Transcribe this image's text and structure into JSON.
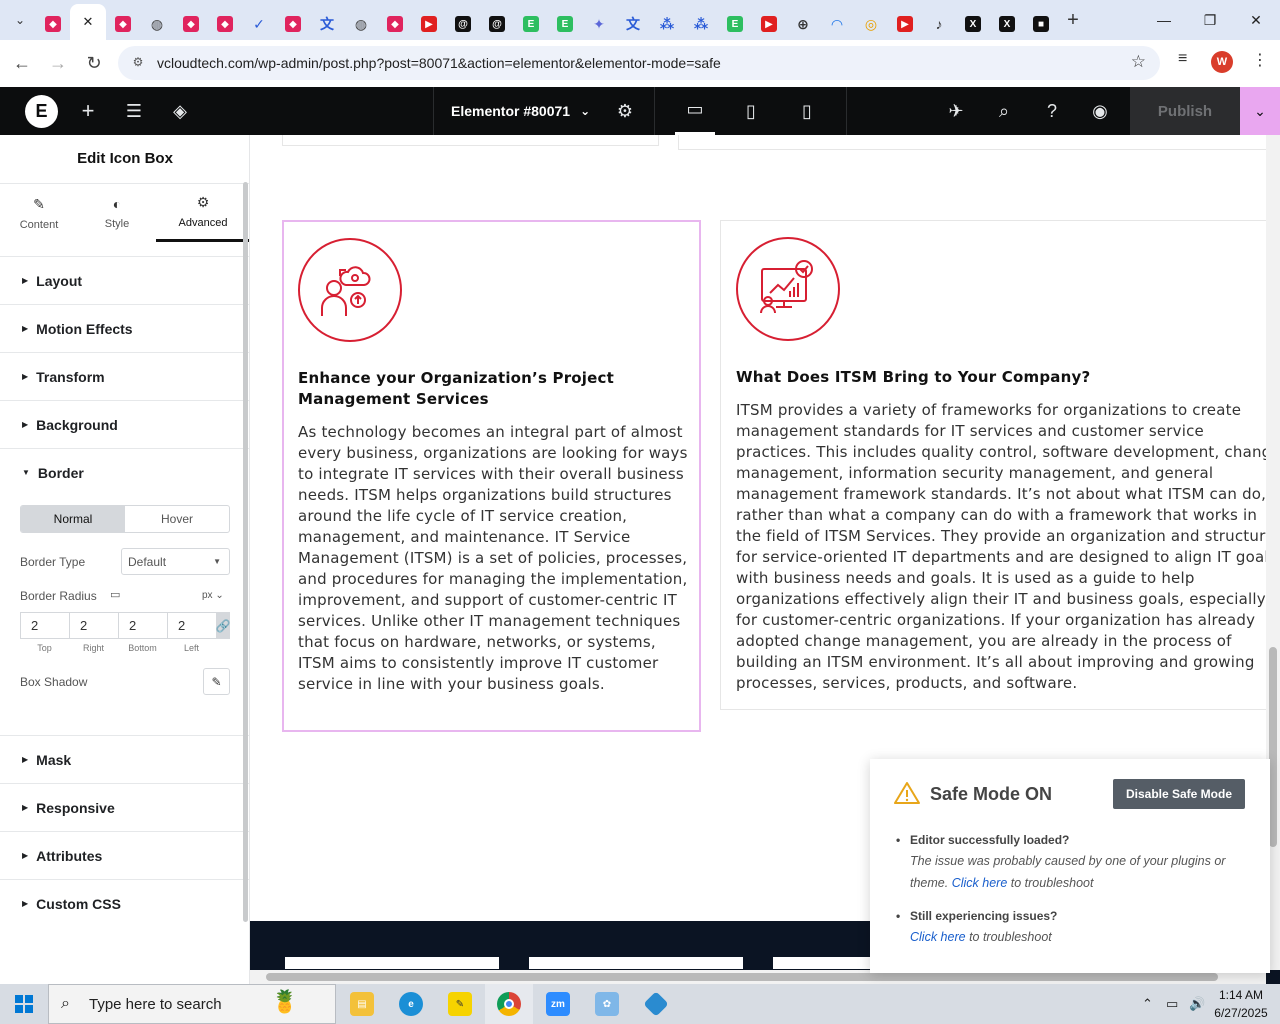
{
  "browser": {
    "url": "vcloudtech.com/wp-admin/post.php?post=80071&action=elementor&elementor-mode=safe",
    "profile_initial": "W",
    "tabs": [
      {
        "icon": "elementor-tab-icon",
        "color": "#e0245e",
        "glyph": "◆"
      },
      {
        "icon": "close-icon",
        "color": "#333",
        "glyph": "✕",
        "active": true
      },
      {
        "icon": "elementor-tab-icon",
        "color": "#e0245e",
        "glyph": "◆"
      },
      {
        "icon": "globe-icon",
        "color": "#444",
        "glyph": "◍"
      },
      {
        "icon": "elementor-tab-icon",
        "color": "#e0245e",
        "glyph": "◆"
      },
      {
        "icon": "elementor-tab-icon",
        "color": "#e0245e",
        "glyph": "◆"
      },
      {
        "icon": "check-icon",
        "color": "#2a5bd7",
        "glyph": "✓"
      },
      {
        "icon": "elementor-tab-icon",
        "color": "#e0245e",
        "glyph": "◆"
      },
      {
        "icon": "translate-icon",
        "color": "#2a5bd7",
        "glyph": "文"
      },
      {
        "icon": "globe-icon",
        "color": "#444",
        "glyph": "◍"
      },
      {
        "icon": "elementor-tab-icon",
        "color": "#e0245e",
        "glyph": "◆"
      },
      {
        "icon": "youtube-icon",
        "color": "#e02020",
        "glyph": "▶"
      },
      {
        "icon": "threads-icon",
        "color": "#111",
        "glyph": "@"
      },
      {
        "icon": "threads-icon",
        "color": "#111",
        "glyph": "@"
      },
      {
        "icon": "evernote-icon",
        "color": "#2dbe60",
        "glyph": "E"
      },
      {
        "icon": "evernote-icon",
        "color": "#2dbe60",
        "glyph": "E"
      },
      {
        "icon": "gemini-icon",
        "color": "#5b67d8",
        "glyph": "✦"
      },
      {
        "icon": "translate-icon",
        "color": "#2a5bd7",
        "glyph": "文"
      },
      {
        "icon": "grid-icon",
        "color": "#2a5bd7",
        "glyph": "⁂"
      },
      {
        "icon": "grid-icon",
        "color": "#2a5bd7",
        "glyph": "⁂"
      },
      {
        "icon": "evernote-icon",
        "color": "#2dbe60",
        "glyph": "E"
      },
      {
        "icon": "youtube-icon",
        "color": "#e02020",
        "glyph": "▶"
      },
      {
        "icon": "lock-icon",
        "color": "#333",
        "glyph": "⊕"
      },
      {
        "icon": "wifi-icon",
        "color": "#1a73e8",
        "glyph": "◠"
      },
      {
        "icon": "circle-icon",
        "color": "#e8a000",
        "glyph": "◎"
      },
      {
        "icon": "youtube-icon",
        "color": "#e02020",
        "glyph": "▶"
      },
      {
        "icon": "audio-icon",
        "color": "#333",
        "glyph": "♪"
      },
      {
        "icon": "x-icon",
        "color": "#111",
        "glyph": "X"
      },
      {
        "icon": "x-icon",
        "color": "#111",
        "glyph": "X"
      },
      {
        "icon": "app-icon",
        "color": "#111",
        "glyph": "■"
      }
    ]
  },
  "elementor": {
    "document_title": "Elementor #80071",
    "publish_label": "Publish",
    "accent": "#e9a7f0"
  },
  "panel": {
    "title": "Edit Icon Box",
    "tabs": [
      {
        "label": "Content",
        "icon": "pencil-icon"
      },
      {
        "label": "Style",
        "icon": "contrast-icon"
      },
      {
        "label": "Advanced",
        "icon": "gear-icon",
        "active": true
      }
    ],
    "sections_top": [
      "Layout",
      "Motion Effects",
      "Transform",
      "Background",
      "Border"
    ],
    "border": {
      "state_normal": "Normal",
      "state_hover": "Hover",
      "border_type_label": "Border Type",
      "border_type_value": "Default",
      "border_radius_label": "Border Radius",
      "unit": "px",
      "radius": {
        "top": "2",
        "right": "2",
        "bottom": "2",
        "left": "2"
      },
      "radius_labels": {
        "top": "Top",
        "right": "Right",
        "bottom": "Bottom",
        "left": "Left"
      },
      "box_shadow_label": "Box Shadow"
    },
    "sections_bottom": [
      "Mask",
      "Responsive",
      "Attributes",
      "Custom CSS"
    ]
  },
  "canvas": {
    "card_left": {
      "heading": "Enhance your Organization’s Project Management Services",
      "body": "As technology becomes an integral part of almost every business, organizations are looking for ways to integrate IT services with their overall business needs. ITSM helps organizations build structures around the life cycle of IT service creation, management, and maintenance. IT Service Management (ITSM) is a set of policies, processes, and procedures for managing the implementation, improvement, and support of customer-centric IT services. Unlike other IT management techniques that focus on hardware, networks, or systems, ITSM aims to consistently improve IT customer service in line with your business goals."
    },
    "card_right": {
      "heading": "What Does ITSM Bring to Your Company?",
      "body": "ITSM provides a variety of frameworks for organizations to create management standards for IT services and customer service practices. This includes quality control, software development, change management, information security management, and general management framework standards. It’s not about what ITSM can do, rather than what a company can do with a framework that works in the field of ITSM Services. They provide an organization and structure for service-oriented IT departments and are designed to align IT goals with business needs and goals. It is used as a guide to help organizations effectively align their IT and business goals, especially for customer-centric organizations. If your organization has already adopted change management, you are already in the process of building an ITSM environment. It’s all about improving and growing processes, services, products, and software."
    },
    "icon_color": "#d71f32"
  },
  "safe_mode": {
    "title": "Safe Mode ON",
    "button": "Disable Safe Mode",
    "item1_title": "Editor successfully loaded?",
    "item1_text_a": "The issue was probably caused by one of your plugins or theme.",
    "item1_link": "Click here",
    "item1_text_b": "to troubleshoot",
    "item2_title": "Still experiencing issues?",
    "item2_link": "Click here",
    "item2_text": "to troubleshoot"
  },
  "taskbar": {
    "search_placeholder": "Type here to search",
    "time": "1:14 AM",
    "date": "6/27/2025",
    "apps": [
      "file-explorer-icon",
      "edge-icon",
      "sticky-notes-icon",
      "chrome-icon",
      "zoom-icon",
      "paint-icon",
      "app-icon"
    ]
  }
}
